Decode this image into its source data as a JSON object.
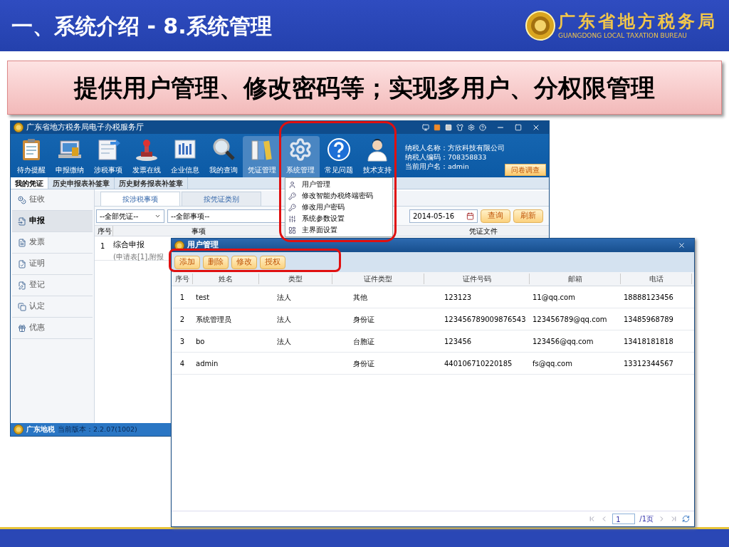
{
  "slide": {
    "title": "一、系统介绍 - 8.系统管理",
    "logo_name": "广东省地方税务局",
    "logo_subtitle": "GUANGDONG LOCAL TAXATION BUREAU",
    "callout": "提供用户管理、修改密码等；实现多用户、分权限管理"
  },
  "app": {
    "title": "广东省地方税务局电子办税服务厅",
    "toolbar": [
      {
        "label": "待办提醒",
        "selected": false
      },
      {
        "label": "申报缴纳",
        "selected": false
      },
      {
        "label": "涉税事项",
        "selected": false
      },
      {
        "label": "发票在线",
        "selected": false
      },
      {
        "label": "企业信息",
        "selected": false
      },
      {
        "label": "我的查询",
        "selected": false
      },
      {
        "label": "凭证管理",
        "selected": true
      },
      {
        "label": "系统管理",
        "selected": true
      },
      {
        "label": "常见问题",
        "selected": false
      },
      {
        "label": "技术支持",
        "selected": false
      }
    ],
    "taxpayer": [
      "纳税人名称：方欣科技有限公司",
      "纳税人编码：708358833",
      "当前用户名：admin"
    ],
    "survey_button": "问卷调查",
    "subtabs": [
      {
        "label": "我的凭证",
        "selected": true
      },
      {
        "label": "历史申报表补签章",
        "selected": false
      },
      {
        "label": "历史财务报表补签章",
        "selected": false
      }
    ],
    "sidebar": [
      {
        "label": "征收",
        "selected": false
      },
      {
        "label": "申报",
        "selected": true
      },
      {
        "label": "发票",
        "selected": false
      },
      {
        "label": "证明",
        "selected": false
      },
      {
        "label": "登记",
        "selected": false
      },
      {
        "label": "认定",
        "selected": false
      },
      {
        "label": "优惠",
        "selected": false
      }
    ],
    "content_tabs": [
      {
        "label": "按涉税事项",
        "selected": true
      },
      {
        "label": "按凭证类别",
        "selected": false
      }
    ],
    "filters": {
      "voucher": "--全部凭证--",
      "item": "--全部事项--",
      "date": "2014-05-16",
      "buttons": [
        "查询",
        "刷新"
      ]
    },
    "table": {
      "columns": [
        "序号",
        "事项",
        "凭证文件"
      ],
      "rows": [
        {
          "index": "1",
          "title": "综合申报",
          "detail": "(申请表[1],附报"
        }
      ]
    },
    "status_bar": {
      "brand": "广东地税",
      "version": "当前版本：2.2.07(1002)"
    }
  },
  "menu": [
    "用户管理",
    "修改智能办税终端密码",
    "修改用户密码",
    "系统参数设置",
    "主界面设置"
  ],
  "dialog": {
    "title": "用户管理",
    "buttons": [
      "添加",
      "删除",
      "修改",
      "授权"
    ],
    "columns": [
      "序号",
      "姓名",
      "类型",
      "证件类型",
      "证件号码",
      "邮箱",
      "电话"
    ],
    "rows": [
      [
        "1",
        "test",
        "法人",
        "其他",
        "123123",
        "11@qq.com",
        "18888123456"
      ],
      [
        "2",
        "系统管理员",
        "法人",
        "身份证",
        "123456789009876543",
        "123456789@qq.com",
        "13485968789"
      ],
      [
        "3",
        "bo",
        "法人",
        "台胞证",
        "123456",
        "123456@qq.com",
        "13418181818"
      ],
      [
        "4",
        "admin",
        "",
        "身份证",
        "440106710220185",
        "fs@qq.com",
        "13312344567"
      ]
    ],
    "pager": {
      "page": "1",
      "total": "/1页"
    }
  }
}
